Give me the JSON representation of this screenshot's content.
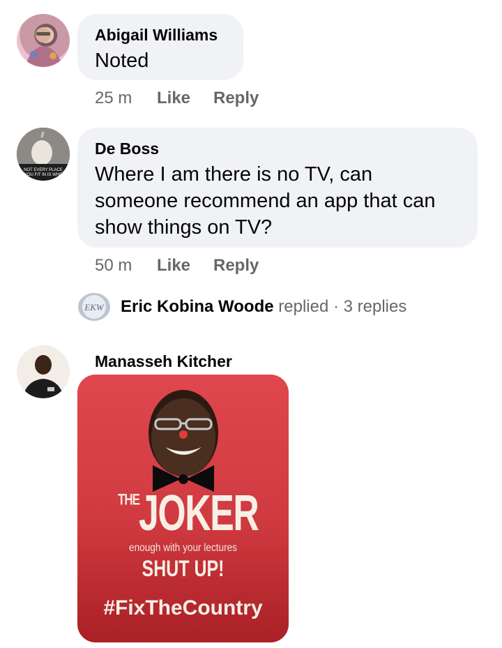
{
  "comments": [
    {
      "author": "Abigail Williams",
      "text": "Noted",
      "time": "25 m",
      "like_label": "Like",
      "reply_label": "Reply"
    },
    {
      "author": "De Boss",
      "text_lines": [
        "Where I am there is no TV, can",
        "someone recommend an app that can",
        "show things on TV?"
      ],
      "time": "50 m",
      "like_label": "Like",
      "reply_label": "Reply",
      "avatar_caption_lines": [
        "NOT EVERY PLACE",
        "YOU FIT IN IS WHE"
      ],
      "reply_summary": {
        "author": "Eric Kobina Woode",
        "action": "replied",
        "separator": "·",
        "count": "3 replies",
        "avatar_label": "EKW"
      }
    },
    {
      "author": "Manasseh Kitcher",
      "image": {
        "the": "THE",
        "title": "JOKER",
        "tagline": "enough with your lectures",
        "headline": "SHUT UP!",
        "hashtag": "#FixTheCountry",
        "background_color": "#d9434a"
      }
    }
  ],
  "colors": {
    "bubble": "#f0f2f5",
    "meta_text": "#65676b",
    "primary_text": "#050505"
  }
}
